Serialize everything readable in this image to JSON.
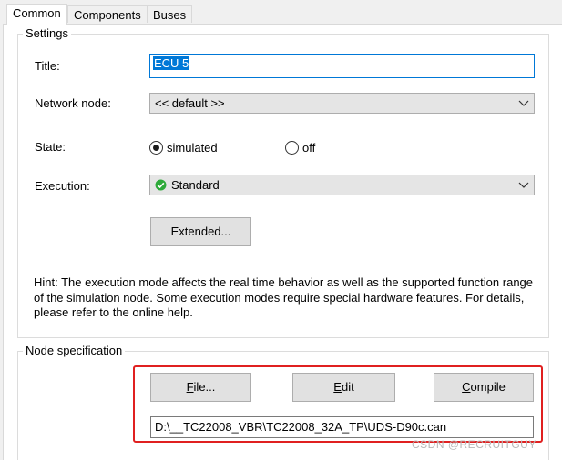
{
  "tabs": [
    {
      "label": "Common",
      "active": true
    },
    {
      "label": "Components",
      "active": false
    },
    {
      "label": "Buses",
      "active": false
    }
  ],
  "settings": {
    "group_title": "Settings",
    "title_label": "Title:",
    "title_value": "ECU 5",
    "network_node_label": "Network node:",
    "network_node_value": "<< default >>",
    "state_label": "State:",
    "state_options": [
      {
        "label": "simulated",
        "selected": true
      },
      {
        "label": "off",
        "selected": false
      }
    ],
    "execution_label": "Execution:",
    "execution_value": "Standard",
    "extended_button": "Extended...",
    "hint": "Hint: The execution mode affects the real time behavior as well as the supported function range of the simulation node. Some execution modes require special hardware features. For details, please refer to the online help."
  },
  "node_specification": {
    "group_title": "Node specification",
    "file_button": {
      "mnemonic": "F",
      "rest": "ile..."
    },
    "edit_button": {
      "mnemonic": "E",
      "rest": "dit"
    },
    "compile_button": {
      "mnemonic": "C",
      "rest": "ompile"
    },
    "file_path": "D:\\__TC22008_VBR\\TC22008_32A_TP\\UDS-D90c.can"
  },
  "watermark": "CSDN @RECRUITGUY",
  "colors": {
    "selection": "#0078d7",
    "highlight_box": "#e02020",
    "check_green": "#2eaa3a"
  }
}
